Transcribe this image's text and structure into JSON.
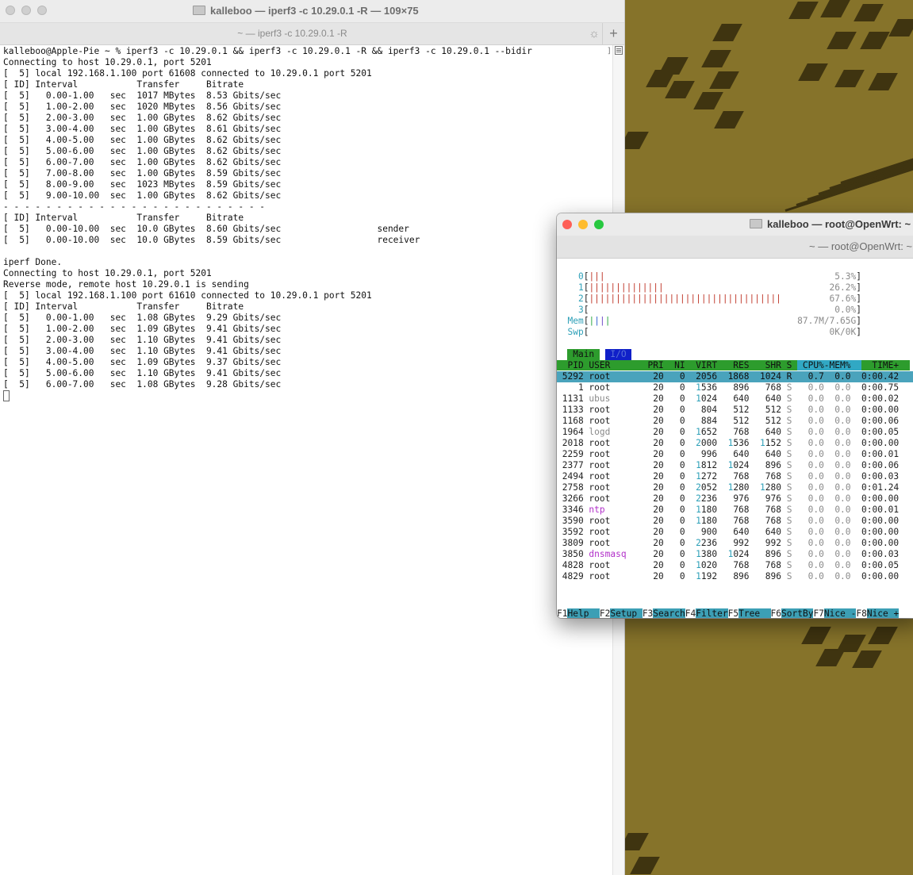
{
  "term1": {
    "title": "kalleboo — iperf3 -c 10.29.0.1 -R — 109×75",
    "tab_title": "~ — iperf3 -c 10.29.0.1 -R",
    "plus": "+",
    "spinner": "☼",
    "lines": [
      "kalleboo@Apple-Pie ~ % iperf3 -c 10.29.0.1 && iperf3 -c 10.29.0.1 -R && iperf3 -c 10.29.0.1 --bidir",
      "Connecting to host 10.29.0.1, port 5201",
      "[  5] local 192.168.1.100 port 61608 connected to 10.29.0.1 port 5201",
      "[ ID] Interval           Transfer     Bitrate",
      "[  5]   0.00-1.00   sec  1017 MBytes  8.53 Gbits/sec",
      "[  5]   1.00-2.00   sec  1020 MBytes  8.56 Gbits/sec",
      "[  5]   2.00-3.00   sec  1.00 GBytes  8.62 Gbits/sec",
      "[  5]   3.00-4.00   sec  1.00 GBytes  8.61 Gbits/sec",
      "[  5]   4.00-5.00   sec  1.00 GBytes  8.62 Gbits/sec",
      "[  5]   5.00-6.00   sec  1.00 GBytes  8.62 Gbits/sec",
      "[  5]   6.00-7.00   sec  1.00 GBytes  8.62 Gbits/sec",
      "[  5]   7.00-8.00   sec  1.00 GBytes  8.59 Gbits/sec",
      "[  5]   8.00-9.00   sec  1023 MBytes  8.59 Gbits/sec",
      "[  5]   9.00-10.00  sec  1.00 GBytes  8.62 Gbits/sec",
      "- - - - - - - - - - - - - - - - - - - - - - - - -",
      "[ ID] Interval           Transfer     Bitrate",
      "[  5]   0.00-10.00  sec  10.0 GBytes  8.60 Gbits/sec                  sender",
      "[  5]   0.00-10.00  sec  10.0 GBytes  8.59 Gbits/sec                  receiver",
      "",
      "iperf Done.",
      "Connecting to host 10.29.0.1, port 5201",
      "Reverse mode, remote host 10.29.0.1 is sending",
      "[  5] local 192.168.1.100 port 61610 connected to 10.29.0.1 port 5201",
      "[ ID] Interval           Transfer     Bitrate",
      "[  5]   0.00-1.00   sec  1.08 GBytes  9.29 Gbits/sec",
      "[  5]   1.00-2.00   sec  1.09 GBytes  9.41 Gbits/sec",
      "[  5]   2.00-3.00   sec  1.10 GBytes  9.41 Gbits/sec",
      "[  5]   3.00-4.00   sec  1.10 GBytes  9.41 Gbits/sec",
      "[  5]   4.00-5.00   sec  1.09 GBytes  9.37 Gbits/sec",
      "[  5]   5.00-6.00   sec  1.10 GBytes  9.41 Gbits/sec",
      "[  5]   6.00-7.00   sec  1.08 GBytes  9.28 Gbits/sec"
    ]
  },
  "term2": {
    "title": "kalleboo — root@OpenWrt: ~",
    "tab_title": "~ — root@OpenWrt: ~",
    "cpu_meters": [
      {
        "label": "0",
        "bars": "|||",
        "value": "5.3%"
      },
      {
        "label": "1",
        "bars": "||||||||||||||",
        "value": "26.2%"
      },
      {
        "label": "2",
        "bars": "||||||||||||||||||||||||||||||||||||",
        "value": "67.6%"
      },
      {
        "label": "3",
        "bars": "",
        "value": "0.0%"
      }
    ],
    "mem": {
      "label": "Mem",
      "bars": "||||",
      "value": "87.7M/7.65G"
    },
    "swp": {
      "label": "Swp",
      "bars": "",
      "value": "0K/0K"
    },
    "tabs": {
      "main": "Main",
      "io": "I/O"
    },
    "header": {
      "pid": "PID",
      "user": "USER",
      "pri": "PRI",
      "ni": "NI",
      "virt": "VIRT",
      "res": "RES",
      "shr": "SHR",
      "s": "S",
      "cpu": "CPU%",
      "mem": "MEM%",
      "time": "TIME+"
    },
    "processes": [
      {
        "pid": "5292",
        "user": "root",
        "pri": "20",
        "ni": "0",
        "virt": "2056",
        "res": "1868",
        "shr": "1024",
        "s": "R",
        "cpu": "0.7",
        "mem": "0.0",
        "time": "0:00.42",
        "selected": true
      },
      {
        "pid": "1",
        "user": "root",
        "pri": "20",
        "ni": "0",
        "virt": "1536",
        "res": "896",
        "shr": "768",
        "s": "S",
        "cpu": "0.0",
        "mem": "0.0",
        "time": "0:00.75"
      },
      {
        "pid": "1131",
        "user": "ubus",
        "pri": "20",
        "ni": "0",
        "virt": "1024",
        "res": "640",
        "shr": "640",
        "s": "S",
        "cpu": "0.0",
        "mem": "0.0",
        "time": "0:00.02"
      },
      {
        "pid": "1133",
        "user": "root",
        "pri": "20",
        "ni": "0",
        "virt": "804",
        "res": "512",
        "shr": "512",
        "s": "S",
        "cpu": "0.0",
        "mem": "0.0",
        "time": "0:00.00"
      },
      {
        "pid": "1168",
        "user": "root",
        "pri": "20",
        "ni": "0",
        "virt": "884",
        "res": "512",
        "shr": "512",
        "s": "S",
        "cpu": "0.0",
        "mem": "0.0",
        "time": "0:00.06"
      },
      {
        "pid": "1964",
        "user": "logd",
        "pri": "20",
        "ni": "0",
        "virt": "1652",
        "res": "768",
        "shr": "640",
        "s": "S",
        "cpu": "0.0",
        "mem": "0.0",
        "time": "0:00.05"
      },
      {
        "pid": "2018",
        "user": "root",
        "pri": "20",
        "ni": "0",
        "virt": "2000",
        "res": "1536",
        "shr": "1152",
        "s": "S",
        "cpu": "0.0",
        "mem": "0.0",
        "time": "0:00.00"
      },
      {
        "pid": "2259",
        "user": "root",
        "pri": "20",
        "ni": "0",
        "virt": "996",
        "res": "640",
        "shr": "640",
        "s": "S",
        "cpu": "0.0",
        "mem": "0.0",
        "time": "0:00.01"
      },
      {
        "pid": "2377",
        "user": "root",
        "pri": "20",
        "ni": "0",
        "virt": "1812",
        "res": "1024",
        "shr": "896",
        "s": "S",
        "cpu": "0.0",
        "mem": "0.0",
        "time": "0:00.06"
      },
      {
        "pid": "2494",
        "user": "root",
        "pri": "20",
        "ni": "0",
        "virt": "1272",
        "res": "768",
        "shr": "768",
        "s": "S",
        "cpu": "0.0",
        "mem": "0.0",
        "time": "0:00.03"
      },
      {
        "pid": "2758",
        "user": "root",
        "pri": "20",
        "ni": "0",
        "virt": "2052",
        "res": "1280",
        "shr": "1280",
        "s": "S",
        "cpu": "0.0",
        "mem": "0.0",
        "time": "0:01.24"
      },
      {
        "pid": "3266",
        "user": "root",
        "pri": "20",
        "ni": "0",
        "virt": "2236",
        "res": "976",
        "shr": "976",
        "s": "S",
        "cpu": "0.0",
        "mem": "0.0",
        "time": "0:00.00"
      },
      {
        "pid": "3346",
        "user": "ntp",
        "pri": "20",
        "ni": "0",
        "virt": "1180",
        "res": "768",
        "shr": "768",
        "s": "S",
        "cpu": "0.0",
        "mem": "0.0",
        "time": "0:00.01"
      },
      {
        "pid": "3590",
        "user": "root",
        "pri": "20",
        "ni": "0",
        "virt": "1180",
        "res": "768",
        "shr": "768",
        "s": "S",
        "cpu": "0.0",
        "mem": "0.0",
        "time": "0:00.00"
      },
      {
        "pid": "3592",
        "user": "root",
        "pri": "20",
        "ni": "0",
        "virt": "900",
        "res": "640",
        "shr": "640",
        "s": "S",
        "cpu": "0.0",
        "mem": "0.0",
        "time": "0:00.00"
      },
      {
        "pid": "3809",
        "user": "root",
        "pri": "20",
        "ni": "0",
        "virt": "2236",
        "res": "992",
        "shr": "992",
        "s": "S",
        "cpu": "0.0",
        "mem": "0.0",
        "time": "0:00.00"
      },
      {
        "pid": "3850",
        "user": "dnsmasq",
        "pri": "20",
        "ni": "0",
        "virt": "1380",
        "res": "1024",
        "shr": "896",
        "s": "S",
        "cpu": "0.0",
        "mem": "0.0",
        "time": "0:00.03"
      },
      {
        "pid": "4828",
        "user": "root",
        "pri": "20",
        "ni": "0",
        "virt": "1020",
        "res": "768",
        "shr": "768",
        "s": "S",
        "cpu": "0.0",
        "mem": "0.0",
        "time": "0:00.05"
      },
      {
        "pid": "4829",
        "user": "root",
        "pri": "20",
        "ni": "0",
        "virt": "1192",
        "res": "896",
        "shr": "896",
        "s": "S",
        "cpu": "0.0",
        "mem": "0.0",
        "time": "0:00.00"
      }
    ],
    "fkeys": [
      {
        "key": "F1",
        "label": "Help  "
      },
      {
        "key": "F2",
        "label": "Setup "
      },
      {
        "key": "F3",
        "label": "Search"
      },
      {
        "key": "F4",
        "label": "Filter"
      },
      {
        "key": "F5",
        "label": "Tree  "
      },
      {
        "key": "F6",
        "label": "SortBy"
      },
      {
        "key": "F7",
        "label": "Nice -"
      },
      {
        "key": "F8",
        "label": "Nice +"
      }
    ]
  },
  "colors": {
    "desktop": "#86732a",
    "tile": "#3f3410",
    "close_red": "#fe5f57",
    "minimize_yellow": "#febc2e",
    "zoom_green": "#28c840",
    "htop_green": "#2d9c2d",
    "htop_cyan": "#31a8c4",
    "htop_selected": "#4aa3bc"
  }
}
